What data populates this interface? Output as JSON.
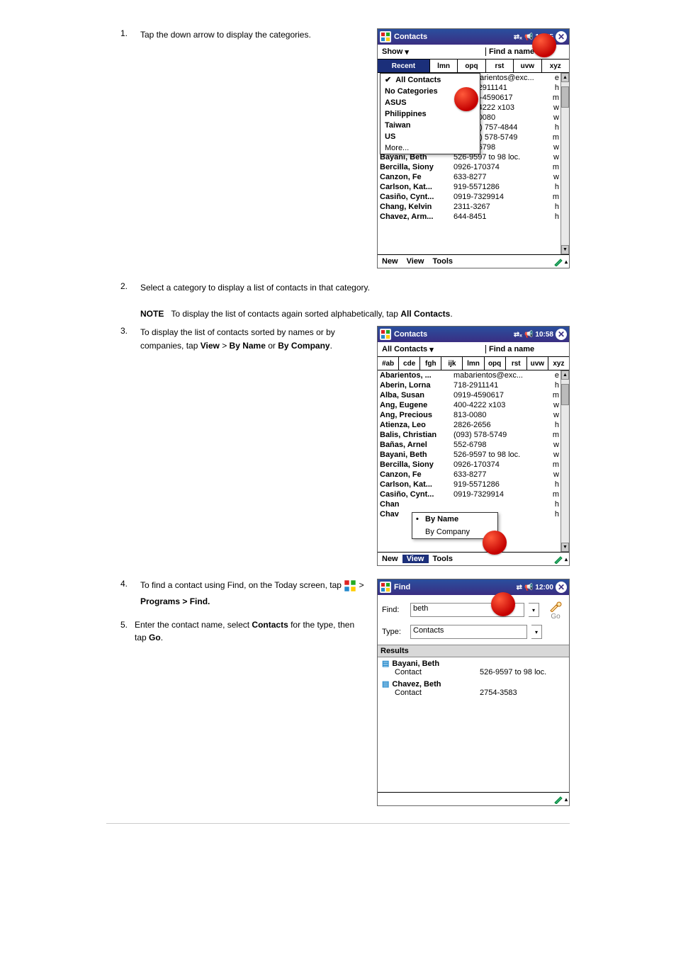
{
  "steps": {
    "s1": {
      "num": "1.",
      "text": "Tap the down arrow to display the categories."
    },
    "s2": {
      "num": "2.",
      "text": "Select a category to display a list of contacts in that category."
    },
    "s_note": "NOTE   To display the list of contacts again sorted alphabetically, tap All Contacts.",
    "s3": {
      "num": "3.",
      "text": "To display the list of contacts sorted by names or by companies, tap View > By Name or By Company."
    },
    "s4a": {
      "num": "4.",
      "text": "To find a contact using Find, on the Today screen, tap"
    },
    "s4b": "Programs > Find.",
    "s5": {
      "num": "5.",
      "text": "Enter the contact name, select Contacts for the type, then tap Go."
    }
  },
  "pda1": {
    "title": "Contacts",
    "time": "10:55",
    "show": "Show",
    "placeholder": "Find a name",
    "alpha_sel": "Recent",
    "alpha": [
      "lmn",
      "opq",
      "rst",
      "uvw",
      "xyz"
    ],
    "menu": {
      "all": "All Contacts",
      "items": [
        "No Categories",
        "ASUS",
        "Philippines",
        "Taiwan",
        "US",
        "More..."
      ]
    },
    "rows": [
      {
        "nm": "",
        "ph": "barientos@exc...",
        "tp": "e"
      },
      {
        "nm": "",
        "ph": "-2911141",
        "tp": "h"
      },
      {
        "nm": "",
        "ph": "9-4590617",
        "tp": "m"
      },
      {
        "nm": "",
        "ph": "-4222 x103",
        "tp": "w"
      },
      {
        "nm": "",
        "ph": "-0080",
        "tp": "w"
      },
      {
        "nm": "",
        "ph": "1) 757-4844",
        "tp": "h"
      },
      {
        "nm": "",
        "ph": "3) 578-5749",
        "tp": "m"
      },
      {
        "nm": "",
        "ph": "-6798",
        "tp": "w"
      },
      {
        "nm": "Bayani, Beth",
        "ph": "526-9597 to 98  loc.",
        "tp": "w"
      },
      {
        "nm": "Bercilla, Siony",
        "ph": "0926-170374",
        "tp": "m"
      },
      {
        "nm": "Canzon, Fe",
        "ph": "633-8277",
        "tp": "w"
      },
      {
        "nm": "Carlson, Kat...",
        "ph": "919-5571286",
        "tp": "h"
      },
      {
        "nm": "Casiño, Cynt...",
        "ph": "0919-7329914",
        "tp": "m"
      },
      {
        "nm": "Chang, Kelvin",
        "ph": "2311-3267",
        "tp": "h"
      },
      {
        "nm": "Chavez, Arm...",
        "ph": "644-8451",
        "tp": "h"
      }
    ],
    "bottom": [
      "New",
      "View",
      "Tools"
    ]
  },
  "pda2": {
    "title": "Contacts",
    "time": "10:58",
    "show": "All Contacts",
    "placeholder": "Find a name",
    "alpha": [
      "#ab",
      "cde",
      "fgh",
      "ijk",
      "lmn",
      "opq",
      "rst",
      "uvw",
      "xyz"
    ],
    "rows": [
      {
        "nm": "Abarientos, ...",
        "ph": "mabarientos@exc...",
        "tp": "e"
      },
      {
        "nm": "Aberin, Lorna",
        "ph": "718-2911141",
        "tp": "h"
      },
      {
        "nm": "Alba, Susan",
        "ph": "0919-4590617",
        "tp": "m"
      },
      {
        "nm": "Ang, Eugene",
        "ph": "400-4222 x103",
        "tp": "w"
      },
      {
        "nm": "Ang, Precious",
        "ph": "813-0080",
        "tp": "w"
      },
      {
        "nm": "Atienza, Leo",
        "ph": "2826-2656",
        "tp": "h"
      },
      {
        "nm": "Balis, Christian",
        "ph": "(093) 578-5749",
        "tp": "m"
      },
      {
        "nm": "Bañas, Arnel",
        "ph": "552-6798",
        "tp": "w"
      },
      {
        "nm": "Bayani, Beth",
        "ph": "526-9597 to 98  loc.",
        "tp": "w"
      },
      {
        "nm": "Bercilla, Siony",
        "ph": "0926-170374",
        "tp": "m"
      },
      {
        "nm": "Canzon, Fe",
        "ph": "633-8277",
        "tp": "w"
      },
      {
        "nm": "Carlson, Kat...",
        "ph": "919-5571286",
        "tp": "h"
      },
      {
        "nm": "Casiño, Cynt...",
        "ph": "0919-7329914",
        "tp": "m"
      },
      {
        "nm": "Chan",
        "ph": "",
        "tp": "h"
      },
      {
        "nm": "Chav",
        "ph": "",
        "tp": "h"
      }
    ],
    "viewmenu": {
      "byName": "By Name",
      "byCompany": "By Company"
    },
    "bottom": [
      "New",
      "View",
      "Tools"
    ]
  },
  "pda3": {
    "title": "Find",
    "time": "12:00",
    "findlabel": "Find:",
    "findval": "beth",
    "typelabel": "Type:",
    "typeval": "Contacts",
    "go": "Go",
    "reshead": "Results",
    "results": [
      {
        "name": "Bayani, Beth",
        "kind": "Contact",
        "val": "526-9597 to 98  loc."
      },
      {
        "name": "Chavez, Beth",
        "kind": "Contact",
        "val": "2754-3583"
      }
    ]
  }
}
